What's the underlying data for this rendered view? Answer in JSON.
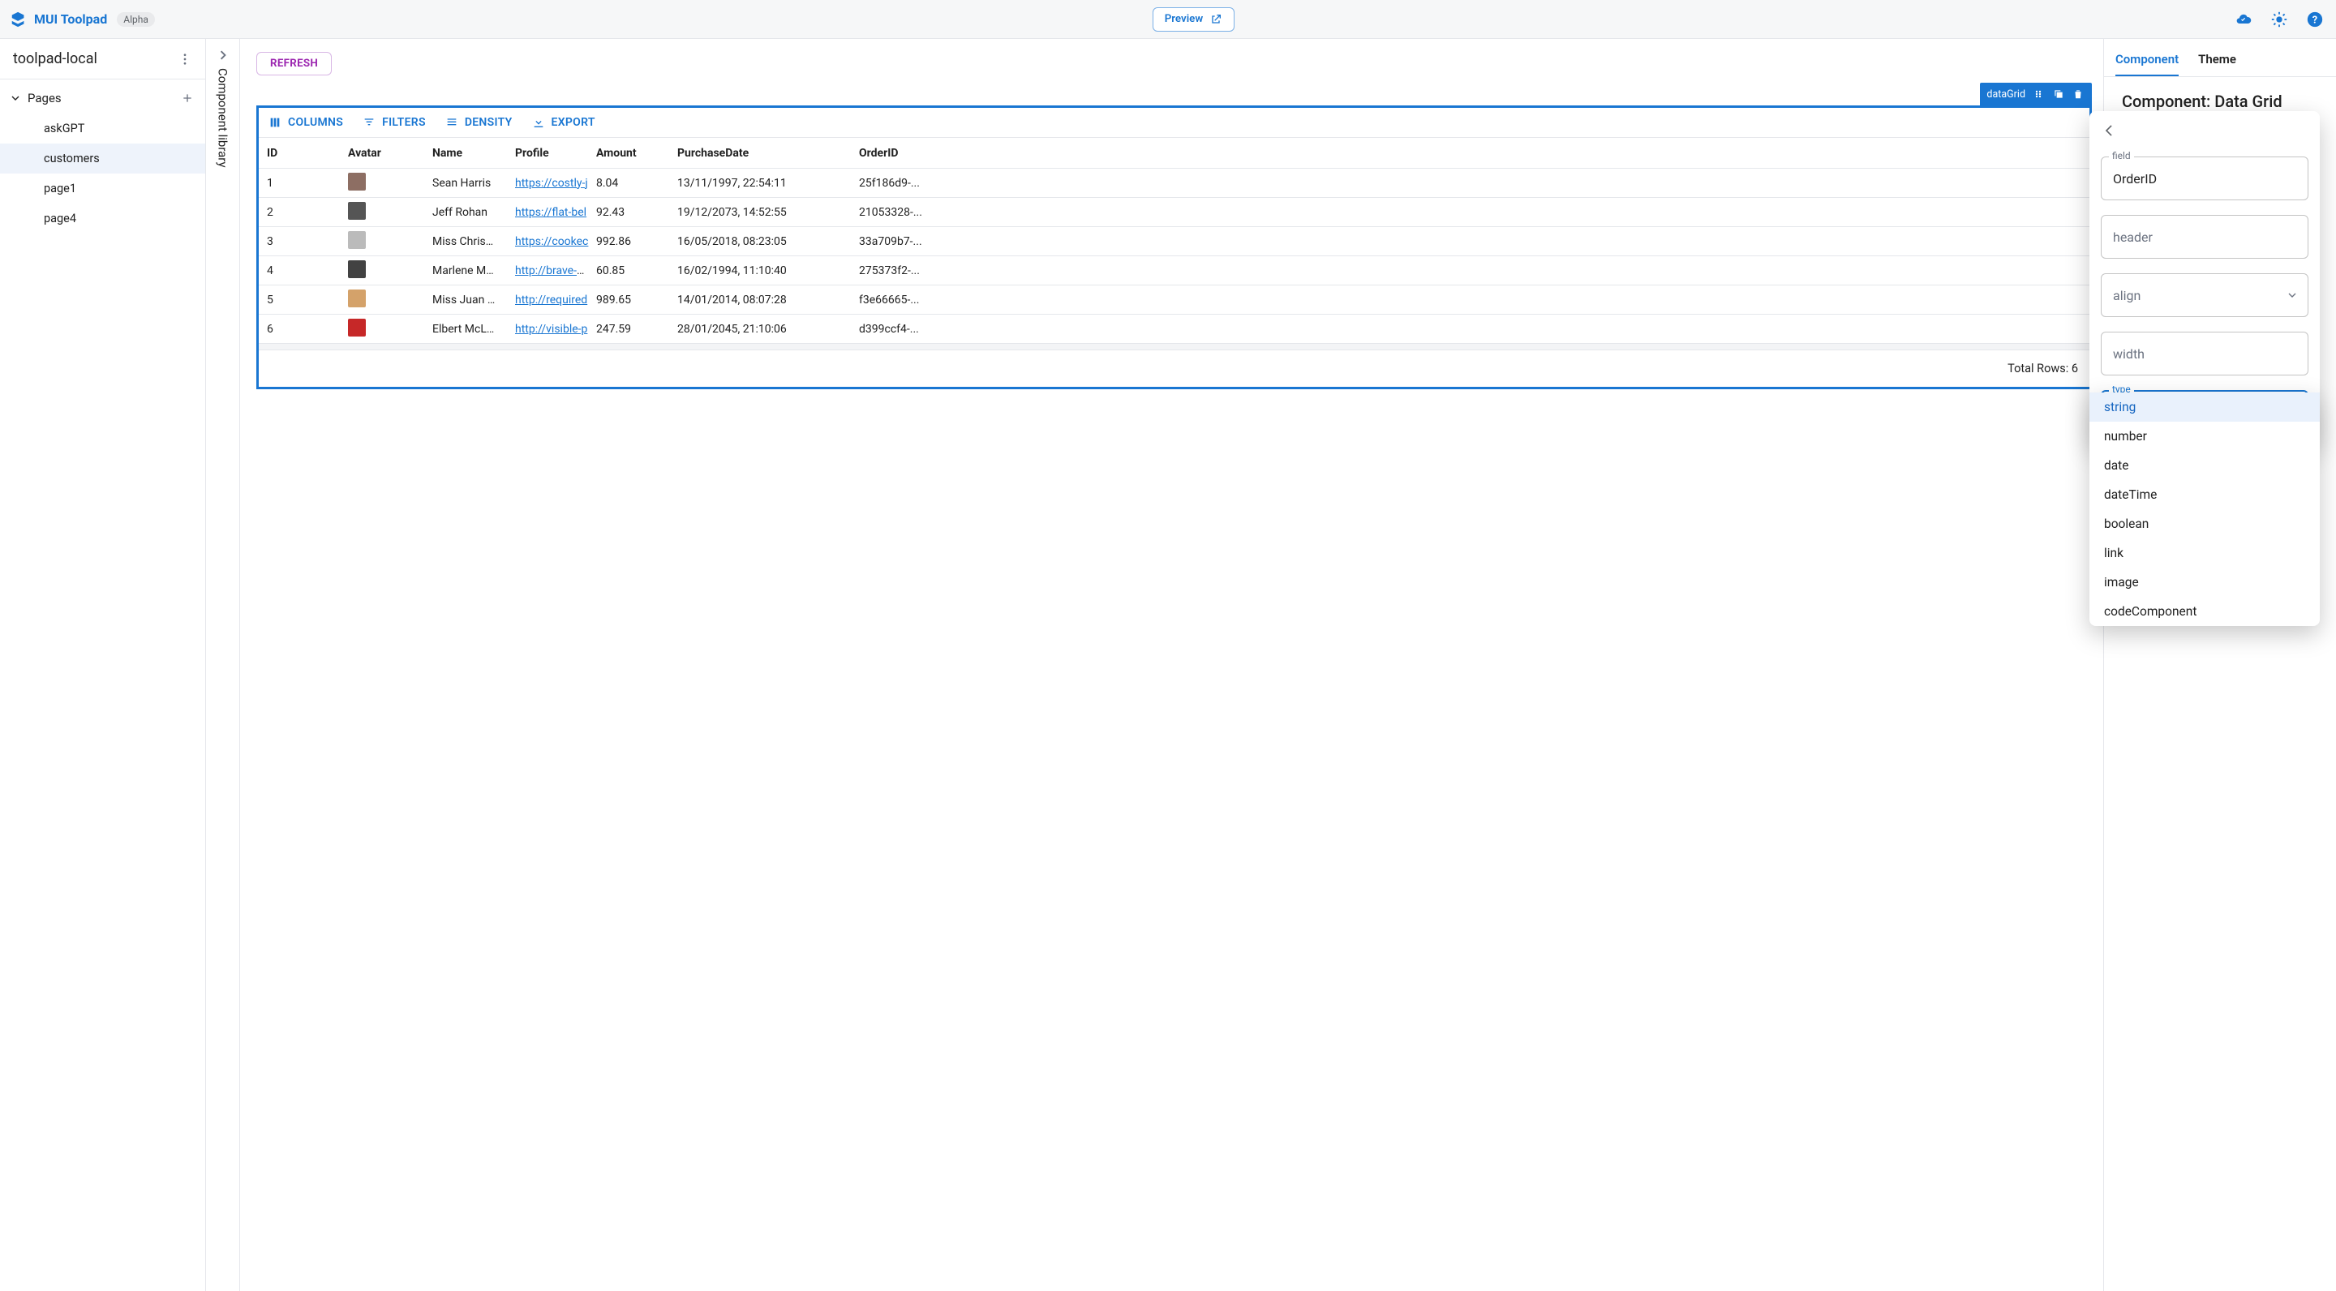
{
  "appbar": {
    "title": "MUI Toolpad",
    "badge": "Alpha",
    "preview": "Preview"
  },
  "sidebar": {
    "project": "toolpad-local",
    "section": "Pages",
    "pages": [
      "askGPT",
      "customers",
      "page1",
      "page4"
    ],
    "active": "customers"
  },
  "rail": {
    "label": "Component library"
  },
  "canvas": {
    "refresh": "REFRESH",
    "sel_label": "dataGrid",
    "grid_toolbar": {
      "columns": "COLUMNS",
      "filters": "FILTERS",
      "density": "DENSITY",
      "export": "EXPORT"
    },
    "columns": [
      "ID",
      "Avatar",
      "Name",
      "Profile",
      "Amount",
      "PurchaseDate",
      "OrderID"
    ],
    "rows": [
      {
        "id": "1",
        "name": "Sean Harris",
        "profile": "https://costly-j",
        "amount": "8.04",
        "date": "13/11/1997, 22:54:11",
        "order": "25f186d9-..."
      },
      {
        "id": "2",
        "name": "Jeff Rohan",
        "profile": "https://flat-bel",
        "amount": "92.43",
        "date": "19/12/2073, 14:52:55",
        "order": "21053328-..."
      },
      {
        "id": "3",
        "name": "Miss Chris…",
        "profile": "https://cookec",
        "amount": "992.86",
        "date": "16/05/2018, 08:23:05",
        "order": "33a709b7-..."
      },
      {
        "id": "4",
        "name": "Marlene M…",
        "profile": "http://brave-we",
        "amount": "60.85",
        "date": "16/02/1994, 11:10:40",
        "order": "275373f2-..."
      },
      {
        "id": "5",
        "name": "Miss Juan …",
        "profile": "http://required",
        "amount": "989.65",
        "date": "14/01/2014, 08:07:28",
        "order": "f3e66665-..."
      },
      {
        "id": "6",
        "name": "Elbert McL…",
        "profile": "http://visible-p",
        "amount": "247.59",
        "date": "28/01/2045, 21:10:06",
        "order": "d399ccf4-..."
      }
    ],
    "footer": "Total Rows: 6"
  },
  "rpanel": {
    "tabs": [
      "Component",
      "Theme"
    ],
    "active": "Component",
    "title": "Component: Data Grid"
  },
  "popover": {
    "field_label": "field",
    "field_value": "OrderID",
    "header_placeholder": "header",
    "align_placeholder": "align",
    "width_placeholder": "width",
    "type_label": "type",
    "type_value": "string",
    "type_options": [
      "string",
      "number",
      "date",
      "dateTime",
      "boolean",
      "link",
      "image",
      "codeComponent"
    ]
  }
}
